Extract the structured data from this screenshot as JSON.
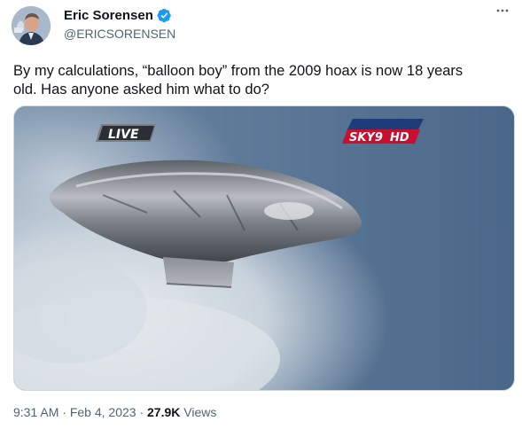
{
  "author": {
    "name": "Eric Sorensen",
    "handle": "@ERICSORENSEN",
    "verified": true
  },
  "tweet": {
    "line1": "By my calculations, “balloon boy” from the 2009 hoax is now 18 years",
    "line2": "old. Has anyone asked him what to do?"
  },
  "media": {
    "live_label": "LIVE",
    "station_label": "SKY9",
    "hd_label": "HD"
  },
  "meta": {
    "time": "9:31 AM",
    "separator": "·",
    "date": "Feb 4, 2023",
    "views_count": "27.9K",
    "views_label": "Views"
  },
  "icons": {
    "verified": "verified-badge-icon",
    "more": "more-icon"
  },
  "colors": {
    "verified_blue": "#1d9bf0",
    "secondary_text": "#536471"
  }
}
